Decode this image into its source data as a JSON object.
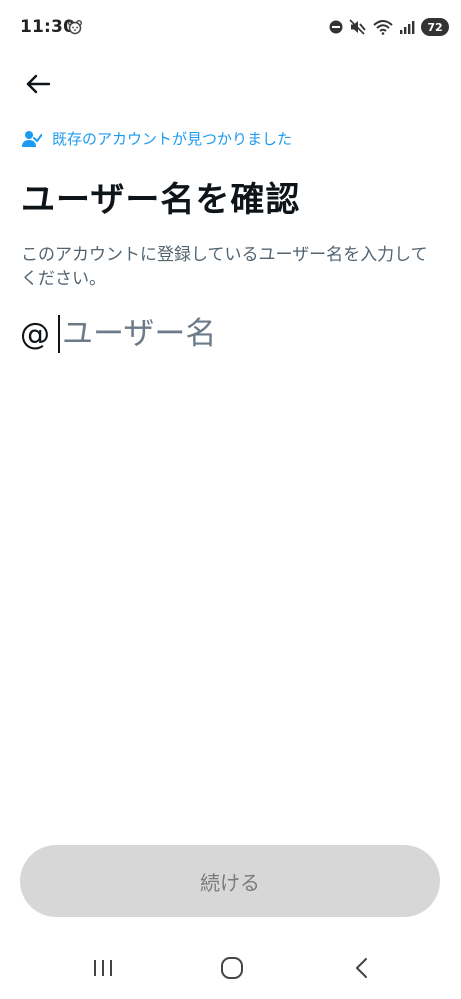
{
  "status_bar": {
    "time": "11:30",
    "battery": "72"
  },
  "header": {
    "found_note": "既存のアカウントが見つかりました",
    "title": "ユーザー名を確認",
    "description": "このアカウントに登録しているユーザー名を入力してください。"
  },
  "username": {
    "prefix": "@",
    "placeholder": "ユーザー名",
    "value": ""
  },
  "actions": {
    "continue_label": "続ける"
  },
  "colors": {
    "accent": "#1d9bf0",
    "button_disabled_bg": "#d7d7d7",
    "button_disabled_text": "#7b7b7b"
  },
  "icons": [
    "bear-icon",
    "dnd-icon",
    "mute-icon",
    "wifi-icon",
    "signal-icon",
    "battery-icon",
    "back-arrow-icon",
    "person-check-icon",
    "nav-recent-icon",
    "nav-home-icon",
    "nav-back-icon"
  ]
}
